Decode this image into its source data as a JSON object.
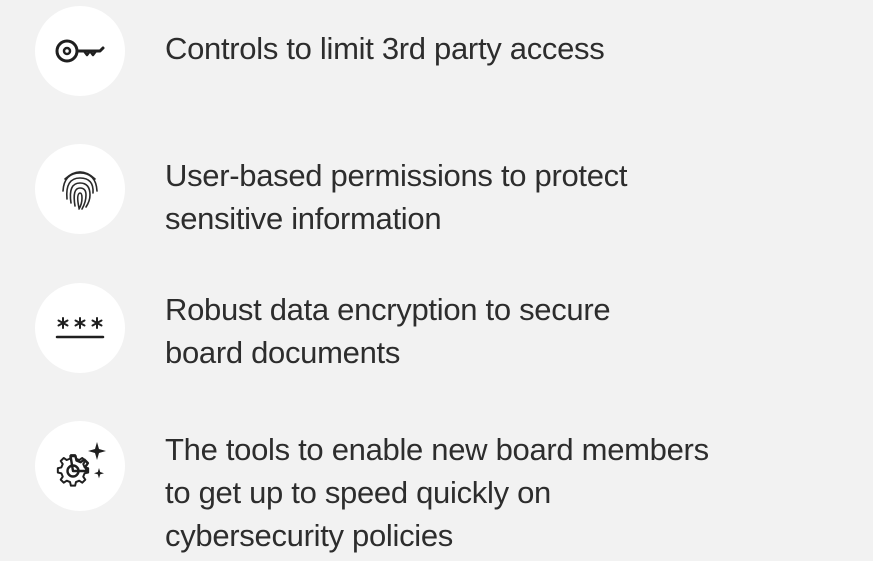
{
  "features": [
    {
      "icon": "key-icon",
      "lines": [
        "Controls to limit 3rd party access"
      ]
    },
    {
      "icon": "fingerprint-icon",
      "lines": [
        "User-based permissions to protect",
        "sensitive information"
      ]
    },
    {
      "icon": "password-asterisks-icon",
      "lines": [
        "Robust data encryption to secure",
        "board documents"
      ]
    },
    {
      "icon": "gear-sparkle-icon",
      "lines": [
        "The tools to enable new board members",
        "to get up to speed quickly on",
        "cybersecurity policies"
      ]
    }
  ],
  "colors": {
    "background": "#f2f2f2",
    "icon_circle": "#ffffff",
    "text": "#2d2d2d",
    "icon_stroke": "#1f1f1f"
  }
}
